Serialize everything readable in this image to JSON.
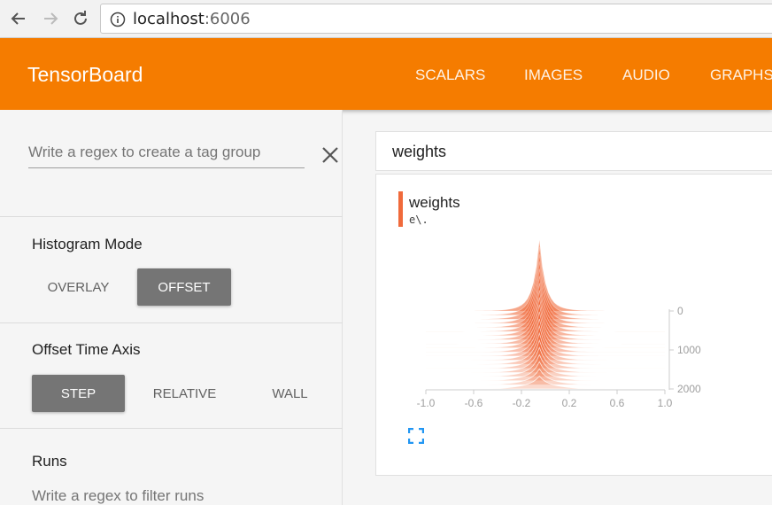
{
  "browser": {
    "url_host": "localhost",
    "url_port": ":6006"
  },
  "app": {
    "title": "TensorBoard",
    "tabs": [
      "SCALARS",
      "IMAGES",
      "AUDIO",
      "GRAPHS"
    ]
  },
  "sidebar": {
    "tag_group_placeholder": "Write a regex to create a tag group",
    "histogram_mode": {
      "label": "Histogram Mode",
      "options": [
        "OVERLAY",
        "OFFSET"
      ],
      "selected": "OFFSET"
    },
    "offset_time_axis": {
      "label": "Offset Time Axis",
      "options": [
        "STEP",
        "RELATIVE",
        "WALL"
      ],
      "selected": "STEP"
    },
    "runs": {
      "label": "Runs",
      "filter_placeholder": "Write a regex to filter runs"
    }
  },
  "main": {
    "section_title": "weights",
    "chart": {
      "title": "weights",
      "run": "e\\.",
      "color": "#f06a3b"
    }
  },
  "chart_data": {
    "type": "histogram-offset",
    "title": "weights",
    "x_ticks": [
      "-1.0",
      "-0.6",
      "-0.2",
      "0.2",
      "0.6",
      "1.0"
    ],
    "xlim": [
      -1.0,
      1.0
    ],
    "y_ticks": [
      "0",
      "1000",
      "2000"
    ],
    "ylim": [
      0,
      2000
    ],
    "series_color": "#f06a3b",
    "distribution": {
      "center": -0.05,
      "steps_shown": 20,
      "peak_height_first_step": 1.0,
      "peak_height_last_step": 0.15
    }
  }
}
